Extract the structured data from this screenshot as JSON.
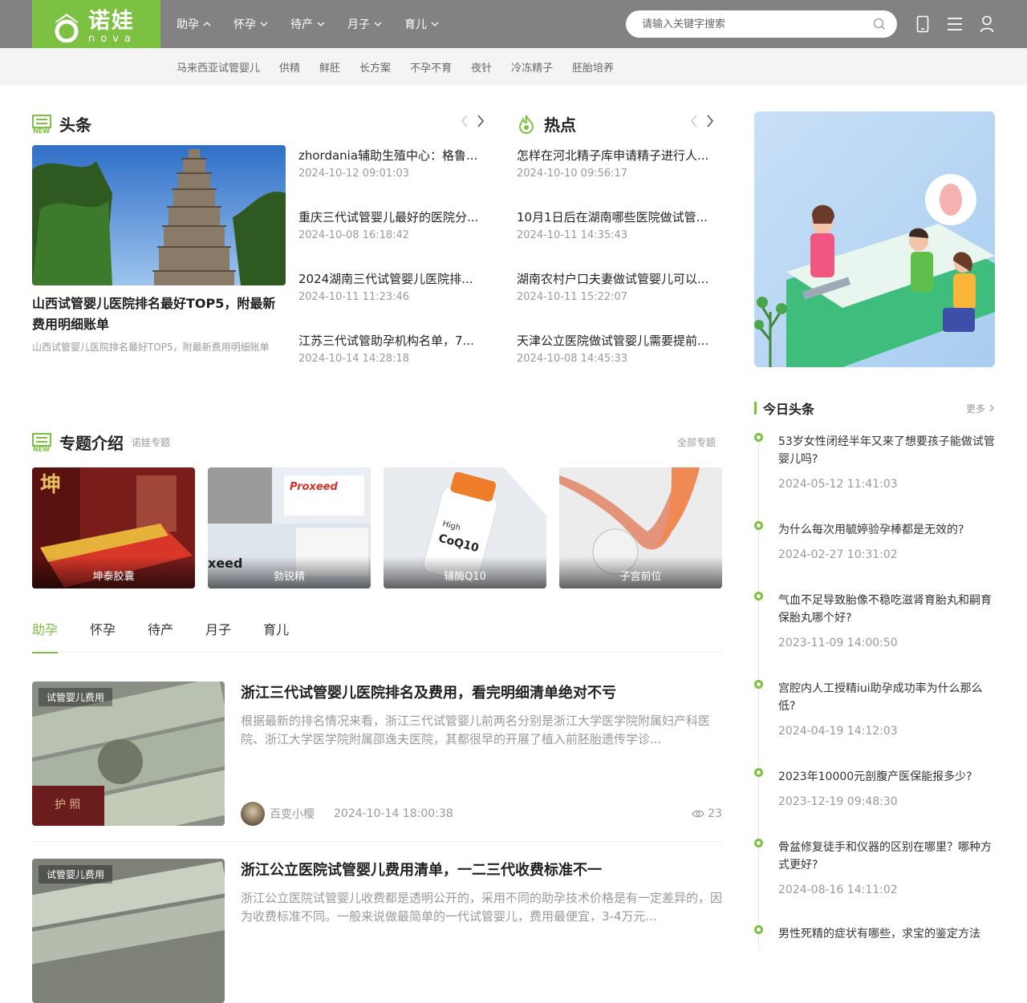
{
  "logo": {
    "cn": "诺娃",
    "en": "nova"
  },
  "nav": [
    {
      "label": "助孕"
    },
    {
      "label": "怀孕"
    },
    {
      "label": "待产"
    },
    {
      "label": "月子"
    },
    {
      "label": "育儿"
    }
  ],
  "search": {
    "placeholder": "请输入关键字搜索"
  },
  "subnav": [
    "马来西亚试管婴儿",
    "供精",
    "鲜胚",
    "长方案",
    "不孕不育",
    "夜针",
    "冷冻精子",
    "胚胎培养"
  ],
  "headlines": {
    "title": "头条",
    "featured": {
      "title": "山西试管婴儿医院排名最好TOP5，附最新费用明细账单",
      "desc": "山西试管婴儿医院排名最好TOP5，附最新费用明细账单"
    },
    "items": [
      {
        "title": "zhordania辅助生殖中心：格鲁...",
        "date": "2024-10-12 09:01:03"
      },
      {
        "title": "重庆三代试管婴儿最好的医院分...",
        "date": "2024-10-08 16:18:42"
      },
      {
        "title": "2024湖南三代试管婴儿医院排...",
        "date": "2024-10-11 11:23:46"
      },
      {
        "title": "江苏三代试管助孕机构名单，7...",
        "date": "2024-10-14 14:28:18"
      }
    ]
  },
  "hot": {
    "title": "热点",
    "items": [
      {
        "title": "怎样在河北精子库申请精子进行人...",
        "date": "2024-10-10 09:56:17"
      },
      {
        "title": "10月1日后在湖南哪些医院做试管...",
        "date": "2024-10-11 14:35:43"
      },
      {
        "title": "湖南农村户口夫妻做试管婴儿可以...",
        "date": "2024-10-11 15:22:07"
      },
      {
        "title": "天津公立医院做试管婴儿需要提前...",
        "date": "2024-10-08 14:45:33"
      }
    ]
  },
  "topics": {
    "title": "专题介绍",
    "subtitle": "诺娃专题",
    "all_label": "全部专题",
    "items": [
      {
        "label": "坤泰胶囊"
      },
      {
        "label": "勃锐精"
      },
      {
        "label": "辅酶Q10"
      },
      {
        "label": "子宫前位"
      }
    ]
  },
  "tabs": [
    {
      "label": "助孕",
      "active": true
    },
    {
      "label": "怀孕"
    },
    {
      "label": "待产"
    },
    {
      "label": "月子"
    },
    {
      "label": "育儿"
    }
  ],
  "articles": [
    {
      "tag": "试管婴儿费用",
      "title": "浙江三代试管婴儿医院排名及费用，看完明细清单绝对不亏",
      "desc": "根据最新的排名情况来看，浙江三代试管婴儿前两名分别是浙江大学医学院附属妇产科医院、浙江大学医学院附属邵逸夫医院，其都很早的开展了植入前胚胎遗传学诊...",
      "author": "百变小樱",
      "date": "2024-10-14 18:00:38",
      "views": "23"
    },
    {
      "tag": "试管婴儿费用",
      "title": "浙江公立医院试管婴儿费用清单，一二三代收费标准不一",
      "desc": "浙江公立医院试管婴儿收费都是透明公开的，采用不同的助孕技术价格是有一定差异的，因为收费标准不同。一般来说做最简单的一代试管婴儿，费用最便宜，3-4万元..."
    }
  ],
  "sidebar": {
    "title": "今日头条",
    "more_label": "更多",
    "items": [
      {
        "title": "53岁女性闭经半年又来了想要孩子能做试管婴儿吗?",
        "date": "2024-05-12 11:41:03"
      },
      {
        "title": "为什么每次用毓婷验孕棒都是无效的?",
        "date": "2024-02-27 10:31:02"
      },
      {
        "title": "气血不足导致胎像不稳吃滋肾育胎丸和嗣育保胎丸哪个好?",
        "date": "2023-11-09 14:00:50"
      },
      {
        "title": "宫腔内人工授精iui助孕成功率为什么那么低?",
        "date": "2024-04-19 14:12:03"
      },
      {
        "title": "2023年10000元剖腹产医保能报多少?",
        "date": "2023-12-19 09:48:30"
      },
      {
        "title": "骨盆修复徒手和仪器的区别在哪里？哪种方式更好?",
        "date": "2024-08-16 14:11:02"
      },
      {
        "title": "男性死精的症状有哪些，求宝的鉴定方法",
        "date": ""
      }
    ]
  },
  "colors": {
    "brand": "#7cc142",
    "topbar": "#828282"
  }
}
